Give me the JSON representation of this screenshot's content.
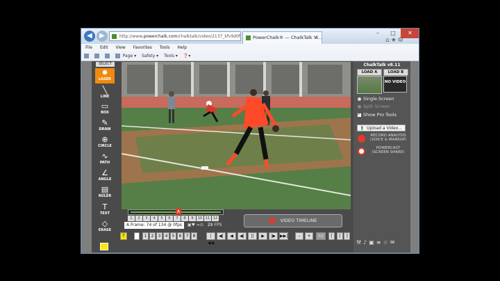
{
  "browser": {
    "url_prefix": "http://www.",
    "url_domain": "powerchalk.com",
    "url_rest": "/chalktalk/video/2137_kfv9d0f",
    "tab_title": "PowerChalk® — ChalkTalk Vi...",
    "tab_close": "×",
    "nav_back": "◀",
    "nav_forward": "▶",
    "win_min": "–",
    "win_max": "□",
    "win_close": "✕",
    "toolbar_icons": "⌂★⚙",
    "menu": [
      "File",
      "Edit",
      "View",
      "Favorites",
      "Tools",
      "Help"
    ],
    "commands": [
      "",
      "",
      "",
      "Page ▾",
      "Safety ▾",
      "Tools ▾",
      "❓▾"
    ]
  },
  "chalktalk": {
    "select_label": "SELECT",
    "tools": [
      {
        "label": "LASER",
        "glyph": "✸"
      },
      {
        "label": "LINE",
        "glyph": "╲"
      },
      {
        "label": "BOX",
        "glyph": "▭"
      },
      {
        "label": "DRAW",
        "glyph": "✎"
      },
      {
        "label": "CIRCLE",
        "glyph": "⊕"
      },
      {
        "label": "PATH",
        "glyph": "∿"
      },
      {
        "label": "ANGLE",
        "glyph": "∠"
      },
      {
        "label": "RULER",
        "glyph": "▤"
      },
      {
        "label": "TEXT",
        "glyph": "T"
      },
      {
        "label": "ERASE",
        "glyph": "◇"
      }
    ],
    "timeline_marker": "A",
    "frame_buttons": [
      "1",
      "2",
      "3",
      "4",
      "5",
      "6",
      "7",
      "8",
      "9",
      "10",
      "11",
      "12"
    ],
    "frame_info": "A Frame: 74 of 134 @ 0fps",
    "fps_value": "29",
    "fps_label": "FPS",
    "video_timeline": "VIDEO TIMELINE",
    "playback": {
      "t_label": "T",
      "slots": [
        "1",
        "2",
        "3",
        "4",
        "5",
        "6",
        "7",
        "8"
      ],
      "transport": [
        "|◀◀",
        "◀|",
        "◀",
        "◀|",
        "||",
        "▶",
        "|▶",
        "▶▶|"
      ],
      "zoom": [
        "–",
        "+"
      ],
      "ab": "AB",
      "brackets": [
        "[",
        "[",
        "]"
      ]
    },
    "version": "ChalkTalk v8.11",
    "load_a": "LOAD A",
    "load_b": "LOAD B",
    "no_video": "NO VIDEO",
    "single_screen": "Single Screen",
    "split_screen": "Split Screen",
    "show_pro_tools": "Show Pro Tools",
    "upload_video": "Upload a Video...",
    "record_title": "RECORD ANALYSIS",
    "record_sub": "(VOICE & MARKUP)",
    "powercast_title": "POWERCAST",
    "powercast_sub": "(SCREEN SHARE)",
    "bottom_icons": "⚒♪▣≡☆✉",
    "colors": {
      "accent": "#f08a0f",
      "record": "#e23a2a",
      "timeline_green": "#6cbe3c"
    }
  }
}
